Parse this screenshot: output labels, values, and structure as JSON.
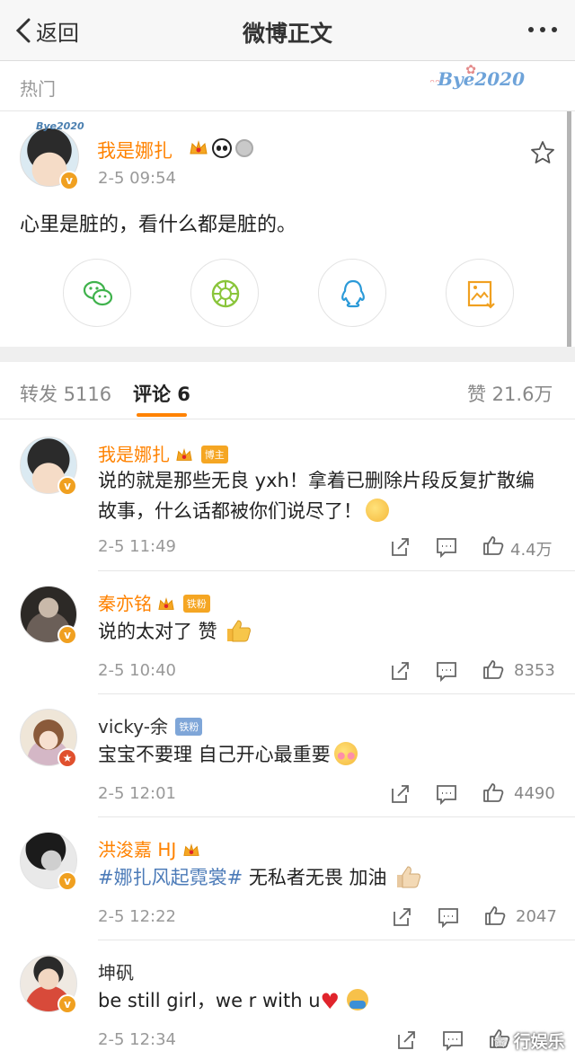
{
  "nav": {
    "back_label": "返回",
    "title": "微博正文"
  },
  "hot": {
    "label": "热门",
    "badge": "Bye2020"
  },
  "post": {
    "author": "我是娜扎",
    "avatar_tag": "Bye2020",
    "time": "2-5 09:54",
    "text": "心里是脏的，看什么都是脏的。",
    "share_buttons": [
      "wechat-icon",
      "moments-icon",
      "qq-icon",
      "save-image-icon"
    ],
    "colors": {
      "wechat": "#3fb24c",
      "moments": "#8ac53b",
      "qq": "#2b9ad8",
      "save": "#f0a020"
    }
  },
  "tabs": {
    "repost": "转发 5116",
    "comments": "评论 6",
    "likes": "赞 21.6万"
  },
  "comments": [
    {
      "name": "我是娜扎",
      "tag": "博主",
      "tag_color": "orange",
      "text": "说的就是那些无良 yxh！拿着已删除片段反复扩散编故事，什么话都被你们说尽了！",
      "time": "2-5 11:49",
      "likes": "4.4万"
    },
    {
      "name": "秦亦铭",
      "tag": "铁粉",
      "tag_color": "orange",
      "text": "说的太对了 赞",
      "time": "2-5 10:40",
      "likes": "8353"
    },
    {
      "name": "vicky-余",
      "tag": "铁粉",
      "tag_color": "blue",
      "text": "宝宝不要理 自己开心最重要",
      "time": "2-5 12:01",
      "likes": "4490"
    },
    {
      "name": "洪浚嘉 HJ",
      "tag": "",
      "hashtag": "#娜扎风起霓裳#",
      "text": " 无私者无畏 加油",
      "time": "2-5 12:22",
      "likes": "2047"
    },
    {
      "name": "坤矾",
      "tag": "",
      "text": "be still girl，we r with u",
      "time": "2-5 12:34",
      "likes": ""
    }
  ],
  "watermark": "☆ 行娱乐",
  "accent": "#ff8200"
}
